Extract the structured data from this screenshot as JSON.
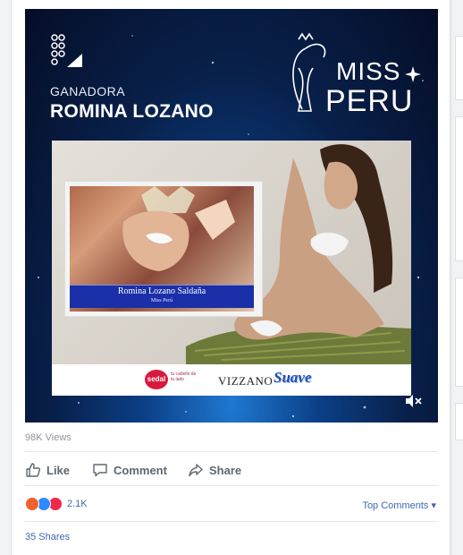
{
  "post": {
    "video": {
      "overlay_label": "GANADORA",
      "winner_name": "ROMINA LOZANO",
      "brand_miss": "MISS",
      "brand_peru": "PERU",
      "caption_name": "Romina Lozano Saldaña",
      "caption_sub": "Miss Perú",
      "sponsors": {
        "sedal": "sedal",
        "sedal_tagline": "tu cabello de tu lado",
        "vizzano": "VIZZANO",
        "suave": "Suave"
      }
    },
    "views": "98K Views",
    "actions": {
      "like": "Like",
      "comment": "Comment",
      "share": "Share"
    },
    "reactions": {
      "count": "2.1K",
      "types": [
        "angry",
        "like",
        "love"
      ],
      "colors": {
        "angry": "#f3602d",
        "like": "#2e89ff",
        "love": "#f0284a"
      }
    },
    "top_comments": "Top Comments ▾",
    "shares": "35 Shares"
  }
}
